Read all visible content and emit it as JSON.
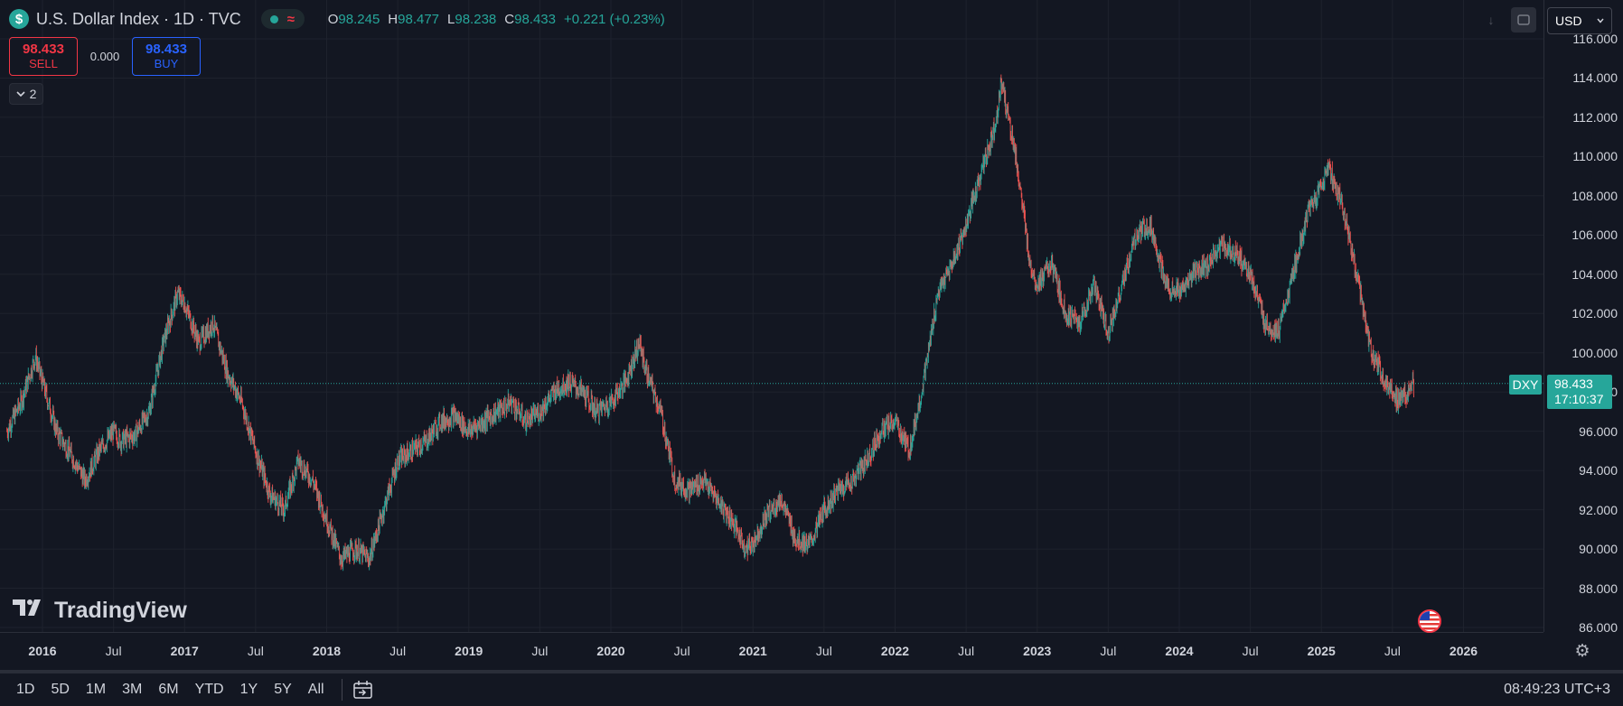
{
  "header": {
    "symbol_icon_char": "$",
    "title": "U.S. Dollar Index · 1D · TVC",
    "ohlc": [
      {
        "key": "O",
        "value": "98.245"
      },
      {
        "key": "H",
        "value": "98.477"
      },
      {
        "key": "L",
        "value": "98.238"
      },
      {
        "key": "C",
        "value": "98.433"
      }
    ],
    "change": "+0.221 (+0.23%)",
    "status_icons": [
      "market-open-dot",
      "wave-icon"
    ]
  },
  "trade": {
    "sell_price": "98.433",
    "sell_label": "SELL",
    "spread": "0.000",
    "buy_price": "98.433",
    "buy_label": "BUY"
  },
  "legend_collapse": {
    "count": "2"
  },
  "currency": {
    "value": "USD"
  },
  "last_price": {
    "symbol": "DXY",
    "price": "98.433",
    "countdown": "17:10:37"
  },
  "watermark": {
    "text": "TradingView"
  },
  "clock": "08:49:23 UTC+3",
  "range_buttons": [
    "1D",
    "5D",
    "1M",
    "3M",
    "6M",
    "YTD",
    "1Y",
    "5Y",
    "All"
  ],
  "colors": {
    "background": "#131722",
    "up": "#26a69a",
    "down": "#ef5350",
    "grid": "#1e222d",
    "axis_text": "#d1d4dc"
  },
  "chart_data": {
    "type": "line",
    "subtype": "candlestick",
    "ylim": [
      85.5,
      116.5
    ],
    "price_ticks": [
      "86.000",
      "88.000",
      "90.000",
      "92.000",
      "94.000",
      "96.000",
      "98.000",
      "100.000",
      "102.000",
      "104.000",
      "106.000",
      "108.000",
      "110.000",
      "112.000",
      "114.000",
      "116.000"
    ],
    "time_ticks": [
      {
        "label": "2016",
        "t": 2016.0,
        "year": true
      },
      {
        "label": "Jul",
        "t": 2016.5,
        "year": false
      },
      {
        "label": "2017",
        "t": 2017.0,
        "year": true
      },
      {
        "label": "Jul",
        "t": 2017.5,
        "year": false
      },
      {
        "label": "2018",
        "t": 2018.0,
        "year": true
      },
      {
        "label": "Jul",
        "t": 2018.5,
        "year": false
      },
      {
        "label": "2019",
        "t": 2019.0,
        "year": true
      },
      {
        "label": "Jul",
        "t": 2019.5,
        "year": false
      },
      {
        "label": "2020",
        "t": 2020.0,
        "year": true
      },
      {
        "label": "Jul",
        "t": 2020.5,
        "year": false
      },
      {
        "label": "2021",
        "t": 2021.0,
        "year": true
      },
      {
        "label": "Jul",
        "t": 2021.5,
        "year": false
      },
      {
        "label": "2022",
        "t": 2022.0,
        "year": true
      },
      {
        "label": "Jul",
        "t": 2022.5,
        "year": false
      },
      {
        "label": "2023",
        "t": 2023.0,
        "year": true
      },
      {
        "label": "Jul",
        "t": 2023.5,
        "year": false
      },
      {
        "label": "2024",
        "t": 2024.0,
        "year": true
      },
      {
        "label": "Jul",
        "t": 2024.5,
        "year": false
      },
      {
        "label": "2025",
        "t": 2025.0,
        "year": true
      },
      {
        "label": "Jul",
        "t": 2025.5,
        "year": false
      },
      {
        "label": "2026",
        "t": 2026.0,
        "year": true
      }
    ],
    "last_value": 98.433,
    "series": [
      {
        "x": [
          2015.75,
          2015.85,
          2015.95,
          2016.0,
          2016.1,
          2016.2,
          2016.3,
          2016.4,
          2016.5,
          2016.55,
          2016.65,
          2016.75,
          2016.85,
          2016.95,
          2017.0,
          2017.1,
          2017.2,
          2017.3,
          2017.4,
          2017.5,
          2017.6,
          2017.7,
          2017.8,
          2017.9,
          2018.0,
          2018.1,
          2018.2,
          2018.3,
          2018.4,
          2018.5,
          2018.6,
          2018.7,
          2018.8,
          2018.9,
          2019.0,
          2019.1,
          2019.2,
          2019.3,
          2019.4,
          2019.5,
          2019.6,
          2019.7,
          2019.8,
          2019.9,
          2020.0,
          2020.1,
          2020.2,
          2020.25,
          2020.35,
          2020.45,
          2020.55,
          2020.65,
          2020.75,
          2020.85,
          2020.95,
          2021.0,
          2021.1,
          2021.2,
          2021.3,
          2021.4,
          2021.5,
          2021.6,
          2021.7,
          2021.8,
          2021.9,
          2022.0,
          2022.1,
          2022.2,
          2022.3,
          2022.4,
          2022.5,
          2022.6,
          2022.7,
          2022.75,
          2022.85,
          2022.95,
          2023.0,
          2023.1,
          2023.2,
          2023.3,
          2023.4,
          2023.5,
          2023.6,
          2023.7,
          2023.8,
          2023.9,
          2024.0,
          2024.1,
          2024.2,
          2024.3,
          2024.4,
          2024.5,
          2024.6,
          2024.7,
          2024.8,
          2024.9,
          2025.0,
          2025.05,
          2025.15,
          2025.25,
          2025.35,
          2025.45,
          2025.55,
          2025.65
        ],
        "y": [
          96.0,
          97.5,
          99.8,
          98.5,
          96.0,
          94.8,
          93.5,
          95.0,
          96.0,
          95.5,
          95.8,
          97.0,
          100.5,
          103.0,
          102.5,
          100.5,
          101.5,
          99.0,
          97.5,
          95.0,
          92.8,
          92.0,
          94.5,
          93.5,
          91.5,
          89.5,
          90.0,
          89.5,
          92.0,
          94.5,
          95.0,
          95.5,
          96.5,
          96.8,
          96.0,
          96.5,
          97.0,
          97.5,
          96.5,
          97.0,
          98.0,
          98.5,
          98.0,
          97.0,
          97.5,
          98.5,
          100.5,
          99.0,
          97.0,
          93.5,
          93.0,
          93.5,
          92.5,
          91.5,
          90.0,
          90.3,
          91.8,
          92.5,
          90.5,
          90.2,
          92.0,
          93.0,
          93.5,
          94.5,
          96.0,
          96.5,
          95.0,
          98.5,
          103.0,
          104.5,
          106.5,
          109.0,
          111.5,
          113.8,
          110.0,
          104.5,
          103.5,
          104.5,
          102.0,
          101.5,
          103.5,
          101.0,
          103.5,
          106.0,
          106.5,
          103.5,
          103.0,
          104.0,
          104.5,
          105.5,
          105.0,
          104.0,
          101.5,
          101.0,
          104.0,
          107.0,
          108.5,
          109.5,
          107.5,
          104.0,
          100.0,
          98.5,
          97.5,
          98.4
        ]
      }
    ]
  }
}
